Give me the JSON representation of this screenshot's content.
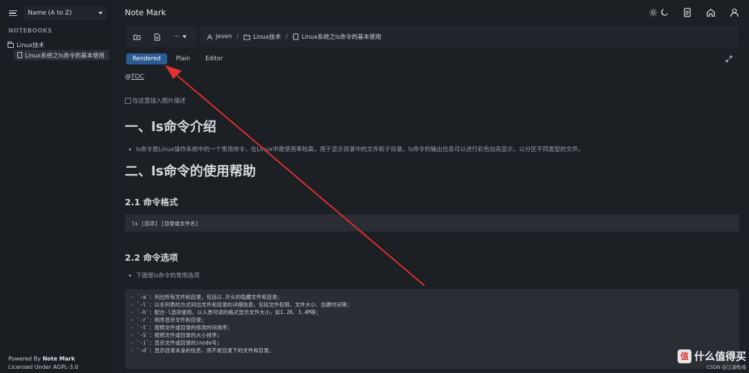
{
  "sidebar": {
    "sort_label": "Name (A to Z)",
    "heading": "NOTEBOOKS",
    "tree": [
      {
        "label": "Linux技术",
        "type": "folder"
      },
      {
        "label": "Linux系统之ls命令的基本使用",
        "type": "note"
      }
    ],
    "footer": {
      "powered_prefix": "Powered By",
      "powered_name": "Note Mark",
      "license": "Licensed Under AGPL-3.0"
    }
  },
  "header": {
    "title": "Note Mark",
    "icons": [
      "sun-icon",
      "moon-icon",
      "document-icon",
      "home-icon",
      "user-icon"
    ]
  },
  "toolbar": {
    "more_label": "···",
    "breadcrumb": [
      "jeven",
      "Linux技术",
      "Linux系统之ls命令的基本使用"
    ]
  },
  "tabs": [
    {
      "label": "Rendered",
      "active": true
    },
    {
      "label": "Plain",
      "active": false
    },
    {
      "label": "Editor",
      "active": false
    }
  ],
  "content": {
    "toc_prefix": "@",
    "toc_link": "TOC",
    "image_alt": "在这里插入图片描述",
    "h1_a": "一、ls命令介绍",
    "bullet_a": "ls命令是Linux操作系统中的一个常用命令，在Linux中是使用率较高，用于显示目录中的文件和子目录。ls命令的输出信息可以进行彩色加亮显示，以分区不同类型的文件。",
    "h1_b": "二、ls命令的使用帮助",
    "h2_a": "2.1 命令格式",
    "code_a": "ls [选项] [目录或文件名]",
    "h2_b": "2.2 命令选项",
    "bullet_b": "下面是ls命令的常用选项",
    "options": [
      "- `-a`：列出所有文件和目录，包括以.开头的隐藏文件和目录；",
      "- `-l`：以长列表的方式列出文件和目录的详细信息，包括文件权限、文件大小、创建时间等；",
      "- `-h`：配合-l选项使用，以人类可读的格式显示文件大小，如1.2K、3.4M等；",
      "- `-r`：倒序显示文件和目录；",
      "- `-t`：按照文件或目录的修改时间排序；",
      "- `-S`：按照文件或目录的大小排序；",
      "- `-i`：显示文件或目录的inode号；",
      "- `-d`：显示目录本身的信息，而不是目录下的文件和目录。"
    ]
  },
  "watermark": {
    "title": "什么值得买",
    "badge": "值",
    "sub": "CSDN @江湖有缘"
  },
  "colors": {
    "accent": "#2c5b93",
    "arrow": "#e03030",
    "background": "#1c1f24"
  }
}
